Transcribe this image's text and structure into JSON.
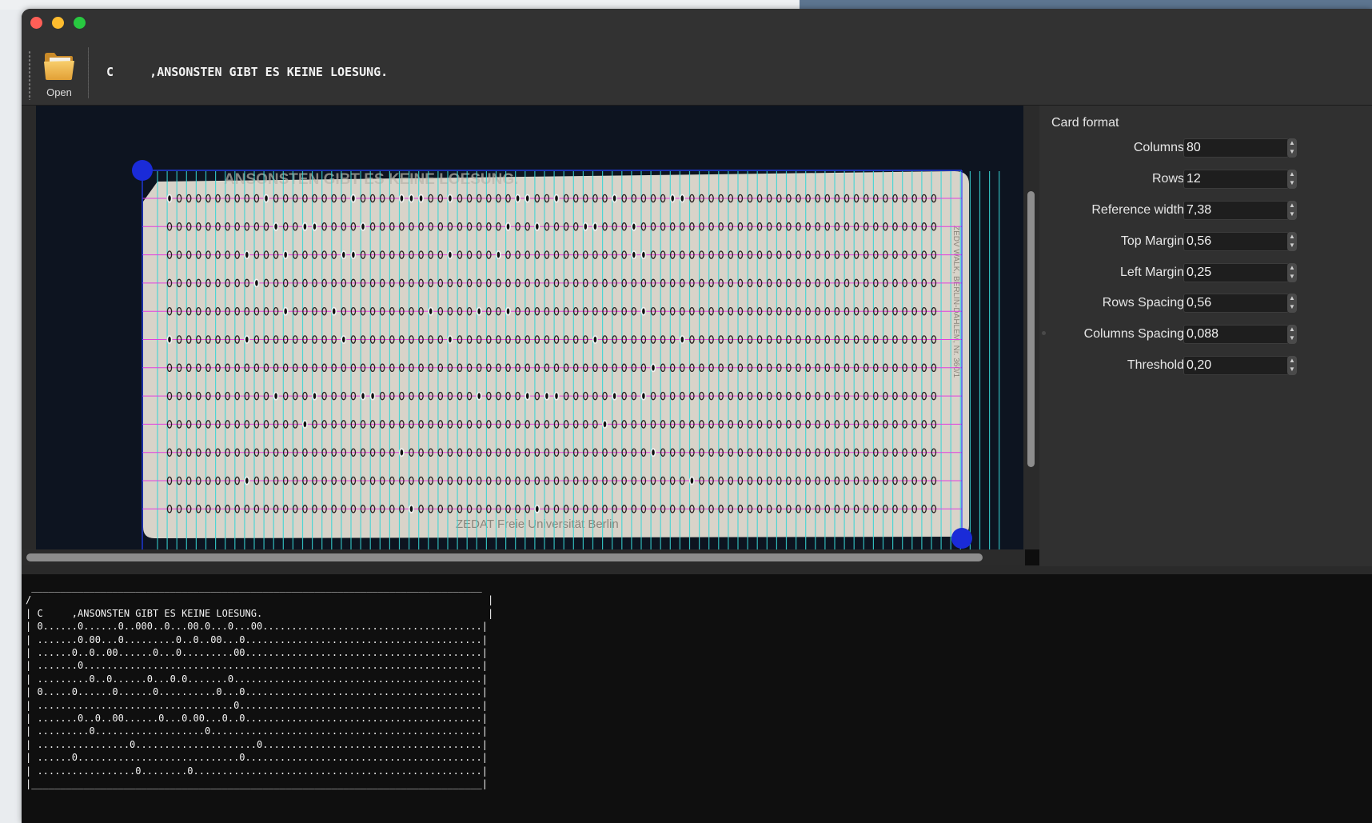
{
  "toolbar": {
    "open_label": "Open",
    "title": "C     ,ANSONSTEN GIBT ES KEINE LOESUNG."
  },
  "card": {
    "printed_header": "ANSONSTEN GIBT ES KEINE LOESUNG.",
    "footer": "ZEDAT Freie Universität Berlin",
    "side_text": "ZEDV WALK, BERLIN-DAHLEM, Nr. 360/1",
    "punches": [
      [
        0,
        10,
        19,
        24,
        25,
        26,
        29,
        36,
        37,
        40,
        46,
        52,
        53
      ],
      [
        11,
        14,
        15,
        20,
        35,
        38,
        43,
        44,
        48
      ],
      [
        8,
        12,
        18,
        19,
        29,
        34,
        48,
        49
      ],
      [
        9
      ],
      [
        12,
        17,
        27,
        32,
        35,
        49
      ],
      [
        0,
        8,
        18,
        29,
        44,
        53
      ],
      [
        50
      ],
      [
        11,
        15,
        20,
        21,
        32,
        37,
        39,
        40,
        46,
        49
      ],
      [
        14,
        45
      ],
      [
        24,
        50
      ],
      [
        8,
        54
      ],
      [
        25,
        38
      ]
    ]
  },
  "card_format": {
    "title": "Card format",
    "fields": [
      {
        "label": "Columns",
        "value": "80"
      },
      {
        "label": "Rows",
        "value": "12"
      },
      {
        "label": "Reference width",
        "value": "7,38"
      },
      {
        "label": "Top Margin",
        "value": "0,56"
      },
      {
        "label": "Left Margin",
        "value": "0,25"
      },
      {
        "label": "Rows Spacing",
        "value": "0,56"
      },
      {
        "label": "Columns Spacing",
        "value": "0,088"
      },
      {
        "label": "Threshold",
        "value": "0,20"
      }
    ]
  },
  "console": {
    "lines": [
      " ______________________________________________________________________________",
      "/                                                                               |",
      "| C     ,ANSONSTEN GIBT ES KEINE LOESUNG.                                       |",
      "| 0......0......0..000..0...00.0...0...00......................................|",
      "| .......0.00...0.........0..0..00...0.........................................|",
      "| ......0..0..00......0...0.........00.........................................|",
      "| .......0.....................................................................|",
      "| .........0..0......0...0.0.......0...........................................|",
      "| 0.....0......0......0..........0...0.........................................|",
      "| ..................................0..........................................|",
      "| .......0..0..00......0...0.00...0..0.........................................|",
      "| .........0...................0...............................................|",
      "| ................0.....................0......................................|",
      "| ......0............................0.........................................|",
      "| .................0........0..................................................|",
      "|______________________________________________________________________________|"
    ]
  }
}
